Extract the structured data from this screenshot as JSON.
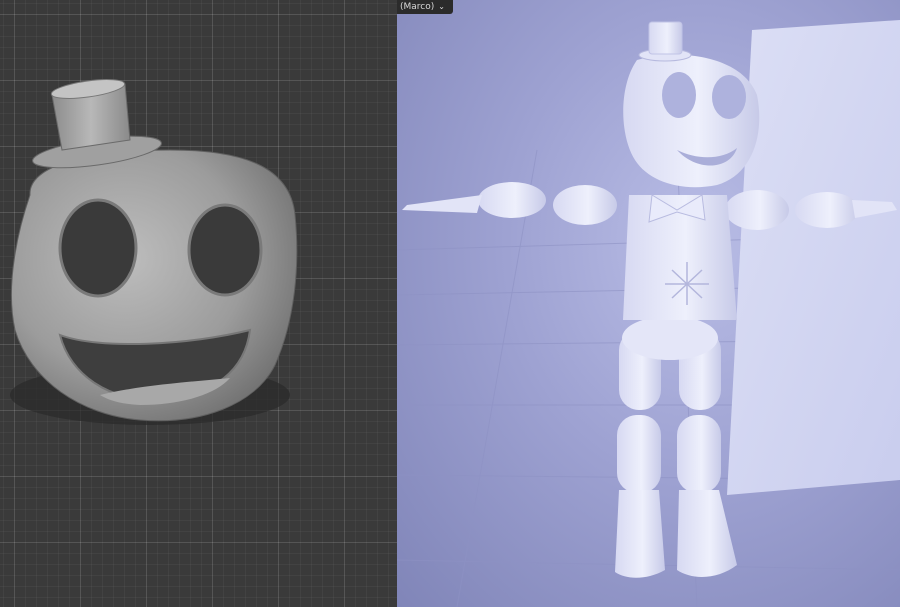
{
  "viewport_left": {
    "background": "#3a3a3a",
    "grid_color": "#5a5a5a",
    "model": "head-with-top-hat"
  },
  "viewport_right": {
    "mode_selector": {
      "label": "(Marco)",
      "icon": "chevron-down-icon"
    },
    "background": "#9ea2d2",
    "model": "full-body-character-t-pose"
  }
}
